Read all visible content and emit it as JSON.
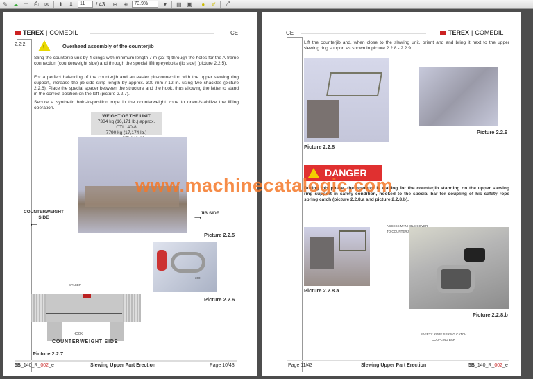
{
  "toolbar": {
    "current_page": "11",
    "total_pages": "/ 43",
    "zoom": "73.9%"
  },
  "brand": {
    "name": "TEREX",
    "sub": "COMEDIL",
    "ce": "CE"
  },
  "left_page": {
    "section_number": "2.2.2",
    "section_title": "Overhead assembly of the counterjib",
    "paragraphs": [
      "Sling the counterjib unit by 4 slings with minimum length 7 m (23 ft) through the holes for the A-frame connection (counterweight side) and through the special lifting eyebolts (jib side) (picture 2.2.5).",
      "For a perfect balancing of the counterjib and an easier pin-connection with the upper slewing ring support, increase the jib-side sling length by approx. 300 mm / 12 in. using two shackles (picture 2.2.6). Place the special spacer between the structure and the hook, thus allowing the latter to stand in the correct position on the left (picture 2.2.7).",
      "Secure a synthetic hold-to-position rope in the counterweight zone to orient/stabilize the lifting operation."
    ],
    "weight_box": {
      "title": "WEIGHT OF THE UNIT",
      "rows": [
        "7334 kg (16,171 lb.) approx. CTL140-8",
        "7790 kg (17,174 lb.) approxCTL140-10"
      ]
    },
    "counterweight_side": "COUNTERWEIGHT SIDE",
    "jib_side": "JIB SIDE",
    "pic_225": "Picture  2.2.5",
    "pic_226": "Picture  2.2.6",
    "pic_227": "Picture  2.2.7",
    "dim_300": "300",
    "spacer": "SPACER",
    "hook": "HOOK",
    "counterweight_side_bottom": "COUNTERWEIGHT  SIDE",
    "footer": {
      "code_a": "5B",
      "code_b": "_140_R_",
      "code_c": "002",
      "code_d": "_e",
      "title": "Slewing Upper Part Erection",
      "page": "Page 10/43"
    }
  },
  "right_page": {
    "intro": "Lift the counterjib and, when close to the slewing unit, orient and and bring it next to the upper slewing ring support as shown in picture 2.2.8 - 2.2.9.",
    "pic_228": "Picture  2.2.8",
    "pic_229": "Picture  2.2.9",
    "danger": "DANGER",
    "danger_text": "During this phase, the operator is waiting for the counterjib standing on the upper slewing ring support in safety condition, hooked to the special bar for coupling of his safety rope spring catch (picture 2.2.8.a and picture 2.2.8.b).",
    "pic_228a": "Picture  2.2.8.a",
    "pic_228b": "Picture  2.2.8.b",
    "manhole_1": "ACCESS MANHOLE COVER",
    "manhole_2": "TO COUNTERJIB LOWER PINS",
    "catch_1": "SAFETY ROPE SPRING CATCH",
    "catch_2": "COUPLING BAR",
    "footer": {
      "page": "Page 11/43",
      "title": "Slewing Upper Part Erection",
      "code_a": "5B",
      "code_b": "_140_R_",
      "code_c": "002",
      "code_d": "_e"
    }
  },
  "watermark": "www.machinecatalogic.com",
  "colors": {
    "danger": "#e03030",
    "brand_red": "#cc2222",
    "watermark": "#f57828"
  }
}
